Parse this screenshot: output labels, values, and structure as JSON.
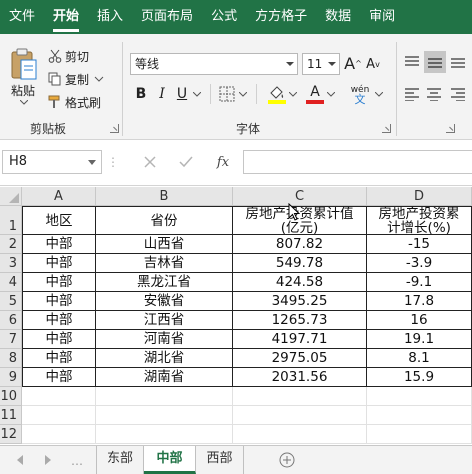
{
  "ribbon_tabs": [
    "文件",
    "开始",
    "插入",
    "页面布局",
    "公式",
    "方方格子",
    "数据",
    "审阅"
  ],
  "active_tab": "开始",
  "clipboard": {
    "paste_label": "粘贴",
    "cut_label": "剪切",
    "copy_label": "复制",
    "format_painter_label": "格式刷",
    "group_label": "剪贴板"
  },
  "font": {
    "name": "等线",
    "size": "11",
    "group_label": "字体",
    "bold": "B",
    "italic": "I",
    "underline": "U",
    "increase_size": "A",
    "decrease_size": "A",
    "phonetic_top": "wén",
    "phonetic_bottom": "文",
    "font_color": "A"
  },
  "formula_bar": {
    "name_box": "H8",
    "function_label": "fx",
    "value": ""
  },
  "columns": [
    "A",
    "B",
    "C",
    "D"
  ],
  "rows": [
    "1",
    "2",
    "3",
    "4",
    "5",
    "6",
    "7",
    "8",
    "9",
    "10",
    "11",
    "12"
  ],
  "table": {
    "headers": [
      "地区",
      "省份",
      "房地产投资累计值(亿元)",
      "房地产投资累计增长(%)"
    ],
    "header_c_line1": "房地产投资累计值",
    "header_c_line2": "(亿元)",
    "header_d_line1": "房地产投资累",
    "header_d_line2": "计增长(%)",
    "rows": [
      [
        "中部",
        "山西省",
        "807.82",
        "-15"
      ],
      [
        "中部",
        "吉林省",
        "549.78",
        "-3.9"
      ],
      [
        "中部",
        "黑龙江省",
        "424.58",
        "-9.1"
      ],
      [
        "中部",
        "安徽省",
        "3495.25",
        "17.8"
      ],
      [
        "中部",
        "江西省",
        "1265.73",
        "16"
      ],
      [
        "中部",
        "河南省",
        "4197.71",
        "19.1"
      ],
      [
        "中部",
        "湖北省",
        "2975.05",
        "8.1"
      ],
      [
        "中部",
        "湖南省",
        "2031.56",
        "15.9"
      ]
    ]
  },
  "sheets": [
    "东部",
    "中部",
    "西部"
  ],
  "active_sheet": "中部",
  "colors": {
    "accent": "#217346",
    "font_color": "#e02020",
    "highlight": "#ffff00"
  }
}
